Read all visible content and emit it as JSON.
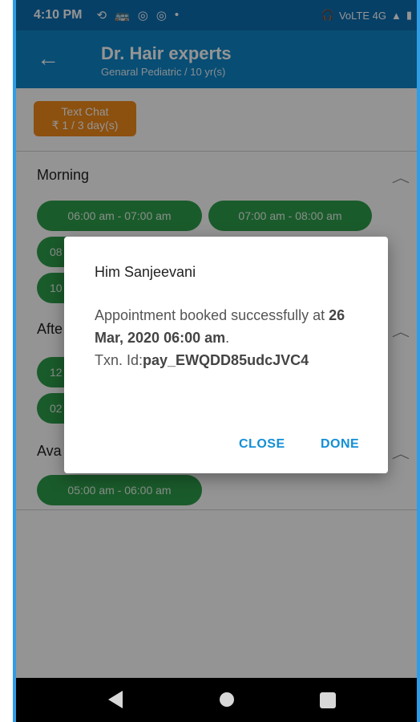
{
  "status_bar": {
    "time": "4:10 PM",
    "left_icons": [
      "sync-icon",
      "bus-icon",
      "instagram-icon",
      "instagram-icon",
      "dot-icon"
    ],
    "right_text": "VoLTE 4G"
  },
  "app_bar": {
    "title": "Dr. Hair experts",
    "subtitle": "Genaral Pediatric / 10 yr(s)"
  },
  "chat_badge": {
    "line1": "Text Chat",
    "line2": "₹ 1 / 3 day(s)"
  },
  "sections": {
    "morning": {
      "title": "Morning",
      "slots": [
        "06:00 am - 07:00 am",
        "07:00 am - 08:00 am",
        "08",
        "10"
      ]
    },
    "afternoon": {
      "title": "Afte",
      "slots": [
        "12",
        "02"
      ]
    },
    "available": {
      "title": "Ava",
      "slots": [
        "05:00 am - 06:00 am"
      ]
    }
  },
  "dialog": {
    "title": "Him Sanjeevani",
    "body_prefix": "Appointment booked successfully at ",
    "body_date": "26 Mar, 2020 06:00 am",
    "body_period": ".",
    "txn_label": "Txn. Id:",
    "txn_id": "pay_EWQDD85udcJVC4",
    "close_label": "CLOSE",
    "done_label": "DONE"
  },
  "colors": {
    "status_bar": "#0d6fb1",
    "app_bar": "#0f85c8",
    "slot_green": "#2e9e4a",
    "badge_orange": "#f18b1b",
    "accent": "#138fd6"
  }
}
